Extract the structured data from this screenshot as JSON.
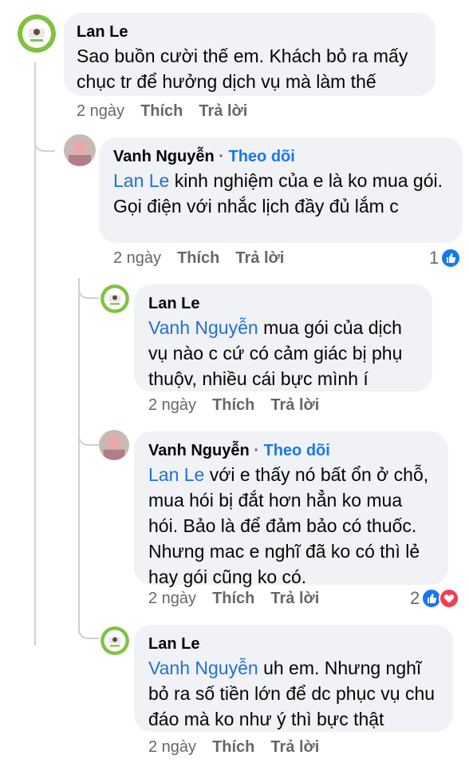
{
  "comments": [
    {
      "author": "Lan Le",
      "text": "Sao buồn cười thế em. Khách bỏ ra mấy chục tr để hưởng dịch vụ mà làm thế",
      "time": "2 ngày",
      "like": "Thích",
      "reply": "Trả lời"
    },
    {
      "author": "Vanh Nguyễn",
      "follow": "Theo dõi",
      "mention": "Lan Le",
      "text": " kinh nghiệm của e là ko mua gói.  Gọi điện với nhắc lịch đầy đủ lắm c",
      "time": "2 ngày",
      "like": "Thích",
      "reply": "Trả lời",
      "reaction_count": "1"
    },
    {
      "author": "Lan Le",
      "mention": "Vanh Nguyễn",
      "text": " mua gói của dịch vụ nào c cứ có cảm giác bị phụ thuộv, nhiều cái bực mình í",
      "time": "2 ngày",
      "like": "Thích",
      "reply": "Trả lời"
    },
    {
      "author": "Vanh Nguyễn",
      "follow": "Theo dõi",
      "mention": "Lan Le",
      "text": " với e thấy nó bất ổn ở chỗ, mua hói bị đắt hơn hẳn ko mua hói. Bảo là để đảm bảo có thuốc. Nhưng mac e nghĩ đã ko có thì lẻ hay gói cũng ko có.",
      "time": "2 ngày",
      "like": "Thích",
      "reply": "Trả lời",
      "reaction_count": "2"
    },
    {
      "author": "Lan Le",
      "mention": "Vanh Nguyễn",
      "text": " uh em. Nhưng nghĩ bỏ ra số tiền lớn để dc phục vụ chu đáo mà ko như ý thì bực thật",
      "time": "2 ngày",
      "like": "Thích",
      "reply": "Trả lời"
    }
  ],
  "separator": "·",
  "colors": {
    "bubble": "#f0f2f5",
    "link": "#1877f2",
    "meta": "#65676b",
    "like_reaction": "#1877f2",
    "love_reaction": "#f33e58"
  },
  "icons": [
    "lan-le-avatar",
    "vanh-avatar",
    "like-reaction-icon",
    "love-reaction-icon"
  ]
}
